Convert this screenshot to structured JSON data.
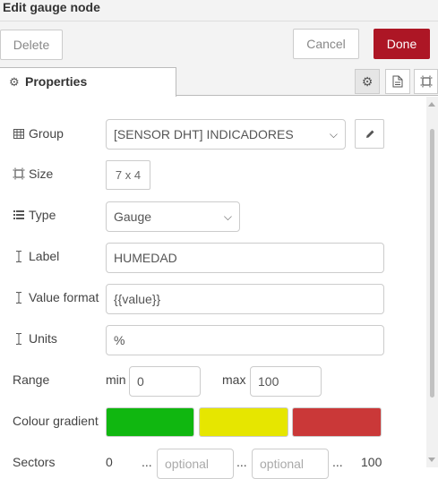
{
  "window": {
    "title": "Edit gauge node"
  },
  "toolbar": {
    "delete_label": "Delete",
    "cancel_label": "Cancel",
    "done_label": "Done"
  },
  "tabs": {
    "properties_label": "Properties"
  },
  "form": {
    "group": {
      "label": "Group",
      "value": "[SENSOR DHT] INDICADORES"
    },
    "size": {
      "label": "Size",
      "value": "7 x 4"
    },
    "type": {
      "label": "Type",
      "value": "Gauge"
    },
    "label": {
      "label": "Label",
      "value": "HUMEDAD"
    },
    "value_format": {
      "label": "Value format",
      "value": "{{value}}"
    },
    "units": {
      "label": "Units",
      "value": "%"
    },
    "range": {
      "label": "Range",
      "min_label": "min",
      "min_value": "0",
      "max_label": "max",
      "max_value": "100"
    },
    "colour_gradient": {
      "label": "Colour gradient",
      "colors": [
        "#10b710",
        "#e6e600",
        "#ca3838"
      ]
    },
    "sectors": {
      "label": "Sectors",
      "start": "0",
      "sep1": "...",
      "placeholder1": "optional",
      "sep2": "...",
      "placeholder2": "optional",
      "sep3": "...",
      "end": "100"
    }
  },
  "colors": {
    "done_button": "#ad1625"
  }
}
